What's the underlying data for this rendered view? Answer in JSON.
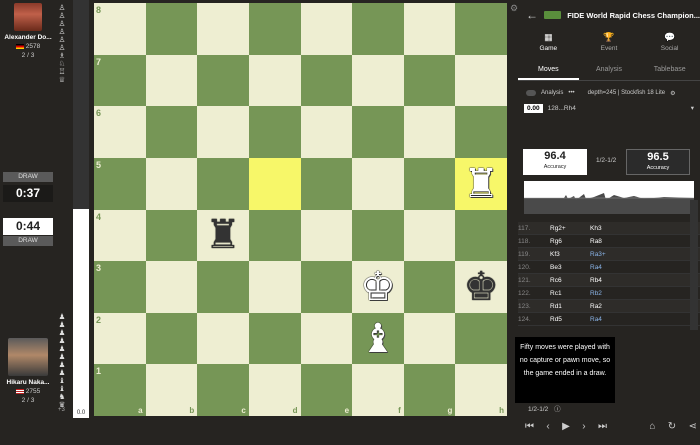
{
  "players": {
    "top": {
      "name": "Alexander Do...",
      "rating": "2578",
      "score": "2 / 3",
      "clock": "0:37",
      "draw_label": "DRAW"
    },
    "bottom": {
      "name": "Hikaru Naka...",
      "rating": "2755",
      "score": "2 / 3",
      "clock": "0:44",
      "draw_label": "DRAW"
    }
  },
  "captured": {
    "top": [
      "♙",
      "♙",
      "♙",
      "♙",
      "♙",
      "♙",
      "♗",
      "♘",
      "♖",
      "♕"
    ],
    "bottom": [
      "♟",
      "♟",
      "♟",
      "♟",
      "♟",
      "♟",
      "♟",
      "♟",
      "♝",
      "♝",
      "♞",
      "♛"
    ],
    "bottom_score": "+3"
  },
  "eval_bar": {
    "label": "0.0",
    "white_fraction": 0.5
  },
  "board": {
    "ranks": [
      "8",
      "7",
      "6",
      "5",
      "4",
      "3",
      "2",
      "1"
    ],
    "files": [
      "a",
      "b",
      "c",
      "d",
      "e",
      "f",
      "g",
      "h"
    ],
    "pieces": [
      {
        "sq": "h5",
        "glyph": "♜",
        "color": "w"
      },
      {
        "sq": "c4",
        "glyph": "♜",
        "color": "b"
      },
      {
        "sq": "f3",
        "glyph": "♚",
        "color": "w"
      },
      {
        "sq": "h3",
        "glyph": "♚",
        "color": "b"
      },
      {
        "sq": "f2",
        "glyph": "♝",
        "color": "w"
      }
    ],
    "highlight": [
      "d5",
      "h5"
    ]
  },
  "panel": {
    "title": "FIDE World Rapid Chess Champion...",
    "nav": [
      {
        "label": "Game",
        "icon": "▦"
      },
      {
        "label": "Event",
        "icon": "🏆"
      },
      {
        "label": "Social",
        "icon": "💬"
      }
    ],
    "tabs": [
      "Moves",
      "Analysis",
      "Tablebase"
    ],
    "analysis_label": "Analysis",
    "engine_info": "depth=245 | Stockfish 18 Lite",
    "line_eval": "0.00",
    "line_moves": "128...Rh4",
    "accuracy": {
      "white": "96.4",
      "black": "96.5",
      "label": "Accuracy",
      "result": "1/2-1/2"
    },
    "moves": [
      {
        "n": "117.",
        "w": "Rg2+",
        "b": "Kh3",
        "blue": false
      },
      {
        "n": "118.",
        "w": "Rg6",
        "b": "Ra8",
        "blue": false
      },
      {
        "n": "119.",
        "w": "Kf3",
        "b": "Ra3+",
        "blue": true
      },
      {
        "n": "120.",
        "w": "Be3",
        "b": "Ra4",
        "blue": true
      },
      {
        "n": "121.",
        "w": "Rc6",
        "b": "Rb4",
        "blue": false
      },
      {
        "n": "122.",
        "w": "Rc1",
        "b": "Rb2",
        "blue": true
      },
      {
        "n": "123.",
        "w": "Rd1",
        "b": "Ra2",
        "blue": false
      },
      {
        "n": "124.",
        "w": "Rd5",
        "b": "Ra4",
        "blue": true
      }
    ],
    "tooltip": "Fifty moves were played with no capture or pawn move, so the game ended in a draw.",
    "result_text": "1/2-1/2"
  }
}
